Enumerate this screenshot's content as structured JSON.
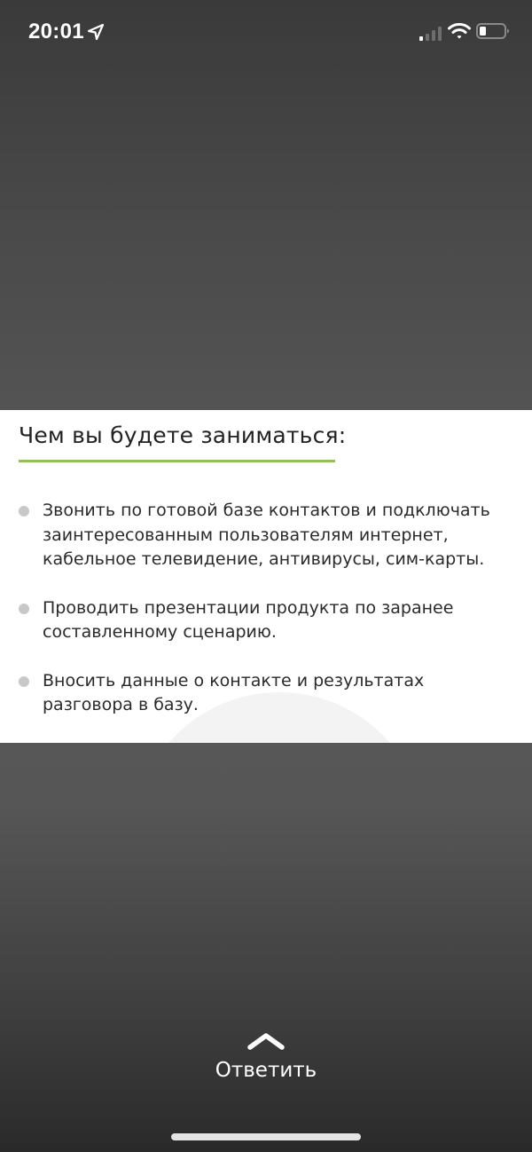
{
  "status_bar": {
    "time": "20:01",
    "icons": [
      "location-arrow-icon",
      "cellular-signal-icon",
      "wifi-icon",
      "battery-icon"
    ]
  },
  "card": {
    "title": "Чем вы будете заниматься:",
    "accent_color": "#93be5a",
    "items": [
      {
        "text": "Звонить по готовой базе контактов и подключать заинтересованным пользователям интернет, кабельное телевидение, антивирусы, сим-карты."
      },
      {
        "text": "Проводить презентации продукта по заранее составленному сценарию."
      },
      {
        "text": "Вносить данные о контакте и результатах разговора в базу."
      }
    ]
  },
  "reply": {
    "label": "Ответить",
    "icon": "chevron-up-icon"
  }
}
